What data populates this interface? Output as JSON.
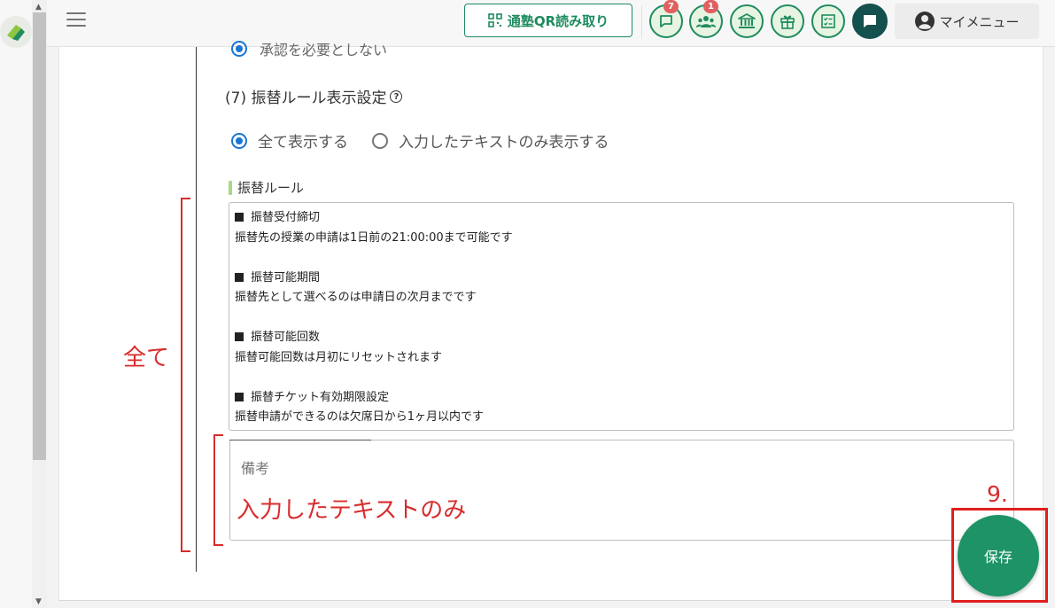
{
  "header": {
    "qr_button_label": "通塾QR読み取り",
    "messages_badge": "7",
    "students_badge": "1",
    "my_menu_label": "マイメニュー"
  },
  "approval_partial": {
    "label": "承認を必要としない"
  },
  "transfer_display": {
    "title": "(7) 振替ルール表示設定",
    "options": [
      {
        "label": "全て表示する",
        "checked": true
      },
      {
        "label": "入力したテキストのみ表示する",
        "checked": false
      }
    ]
  },
  "transfer_rules": {
    "label": "振替ルール",
    "items": [
      {
        "heading": "振替受付締切",
        "text": "振替先の授業の申請は1日前の21:00:00まで可能です"
      },
      {
        "heading": "振替可能期間",
        "text": "振替先として選べるのは申請日の次月までです"
      },
      {
        "heading": "振替可能回数",
        "text": "振替可能回数は月初にリセットされます"
      },
      {
        "heading": "振替チケット有効期限設定",
        "text": "振替申請ができるのは欠席日から1ヶ月以内です"
      }
    ]
  },
  "memo": {
    "label": "備考"
  },
  "annotations": {
    "all_label": "全て",
    "input_only_label": "入力したテキストのみ",
    "step_number": "9."
  },
  "save_button": {
    "label": "保存"
  },
  "colors": {
    "brand_green": "#1e8c5f",
    "save_green": "#1e9366",
    "annotation_red": "#d82c2c",
    "radio_blue": "#1976d2"
  }
}
